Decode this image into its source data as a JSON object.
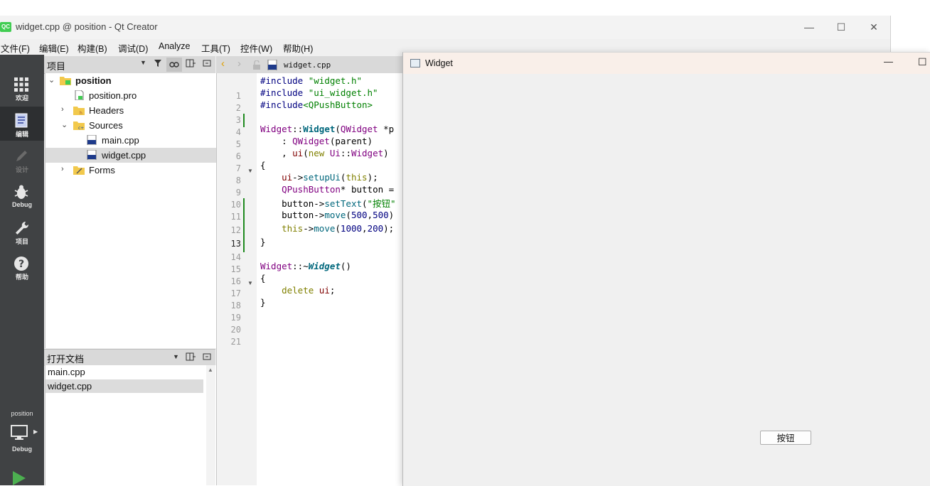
{
  "window": {
    "title": "widget.cpp @ position - Qt Creator",
    "logo": "QC",
    "minimize": "—",
    "maximize": "☐",
    "close": "✕"
  },
  "menu": [
    "文件(F)",
    "编辑(E)",
    "构建(B)",
    "调试(D)",
    "Analyze",
    "工具(T)",
    "控件(W)",
    "帮助(H)"
  ],
  "modes": [
    {
      "label": "欢迎",
      "icon": "grid-icon"
    },
    {
      "label": "编辑",
      "icon": "document-icon"
    },
    {
      "label": "设计",
      "icon": "pencil-icon"
    },
    {
      "label": "Debug",
      "icon": "bug-icon"
    },
    {
      "label": "项目",
      "icon": "wrench-icon"
    },
    {
      "label": "帮助",
      "icon": "help-icon"
    }
  ],
  "kit": {
    "project": "position",
    "config": "Debug"
  },
  "project_pane": {
    "title": "项目",
    "tree": [
      "position",
      "position.pro",
      "Headers",
      "Sources",
      "main.cpp",
      "widget.cpp",
      "Forms"
    ]
  },
  "open_docs": {
    "title": "打开文档",
    "items": [
      "main.cpp",
      "widget.cpp"
    ]
  },
  "editor": {
    "file_tab": "widget.cpp",
    "current_line": 13,
    "line_numbers": [
      "1",
      "2",
      "3",
      "4",
      "5",
      "6",
      "7",
      "8",
      "9",
      "10",
      "11",
      "12",
      "13",
      "14",
      "15",
      "16",
      "17",
      "18",
      "19",
      "20",
      "21"
    ],
    "lines": [
      "#include \"widget.h\"",
      "#include \"ui_widget.h\"",
      "#include<QPushButton>",
      "",
      "Widget::Widget(QWidget *p",
      "    : QWidget(parent)",
      "    , ui(new Ui::Widget)",
      "{",
      "    ui->setupUi(this);",
      "    QPushButton* button =",
      "    button->setText(\"按钮\"",
      "    button->move(500,500)",
      "    this->move(1000,200);",
      "}",
      "",
      "Widget::~Widget()",
      "{",
      "    delete ui;",
      "}",
      "",
      ""
    ]
  },
  "widget_window": {
    "title": "Widget",
    "button_label": "按钮",
    "minimize": "—",
    "maximize": "☐"
  },
  "colors": {
    "modebar": "#404244",
    "change_marker": "#1f8a1f",
    "keyword": "#808000",
    "string": "#008000",
    "type": "#800080"
  }
}
